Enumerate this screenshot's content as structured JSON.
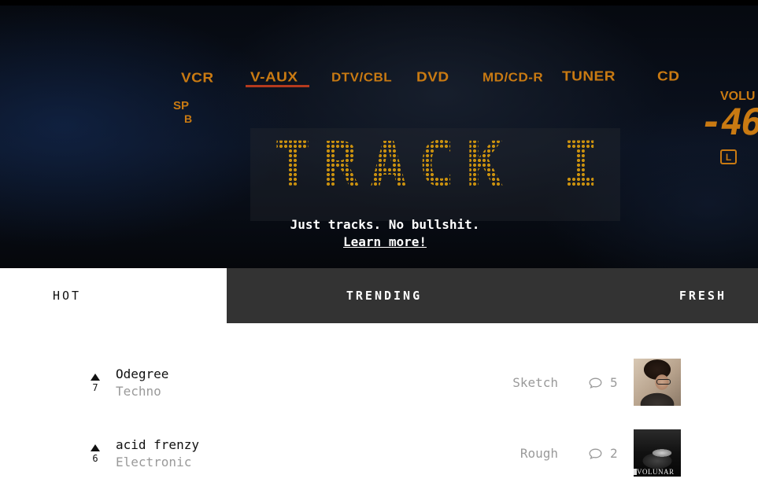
{
  "hero": {
    "sources": [
      "VCR",
      "V-AUX",
      "DTV/CBL",
      "DVD",
      "MD/CD-R",
      "TUNER",
      "CD"
    ],
    "active_source": "V-AUX",
    "sp_label": "SP",
    "sp_sub": "B",
    "volume_label": "VOLU",
    "volume_digits": "-46",
    "channel_indicator": "L",
    "title": "TRACK IT",
    "tagline": "Just tracks. No bullshit.",
    "learn_more": "Learn more!"
  },
  "tabs": [
    {
      "label": "HOT",
      "active": true
    },
    {
      "label": "TRENDING",
      "active": false
    },
    {
      "label": "FRESH",
      "active": false
    }
  ],
  "tracks": [
    {
      "votes": "7",
      "title": "Odegree",
      "genre": "Techno",
      "stage": "Sketch",
      "comments": "5",
      "thumb_icon": "artist-photo"
    },
    {
      "votes": "6",
      "title": "acid frenzy",
      "genre": "Electronic",
      "stage": "Rough",
      "comments": "2",
      "thumb_icon": "turntable-photo",
      "thumb_brand": "VOLUNAR"
    }
  ],
  "colors": {
    "accent_amber": "#c97a12",
    "tab_bar": "#333333",
    "muted_text": "#9a9a9a",
    "active_underline": "#b53a1e"
  }
}
